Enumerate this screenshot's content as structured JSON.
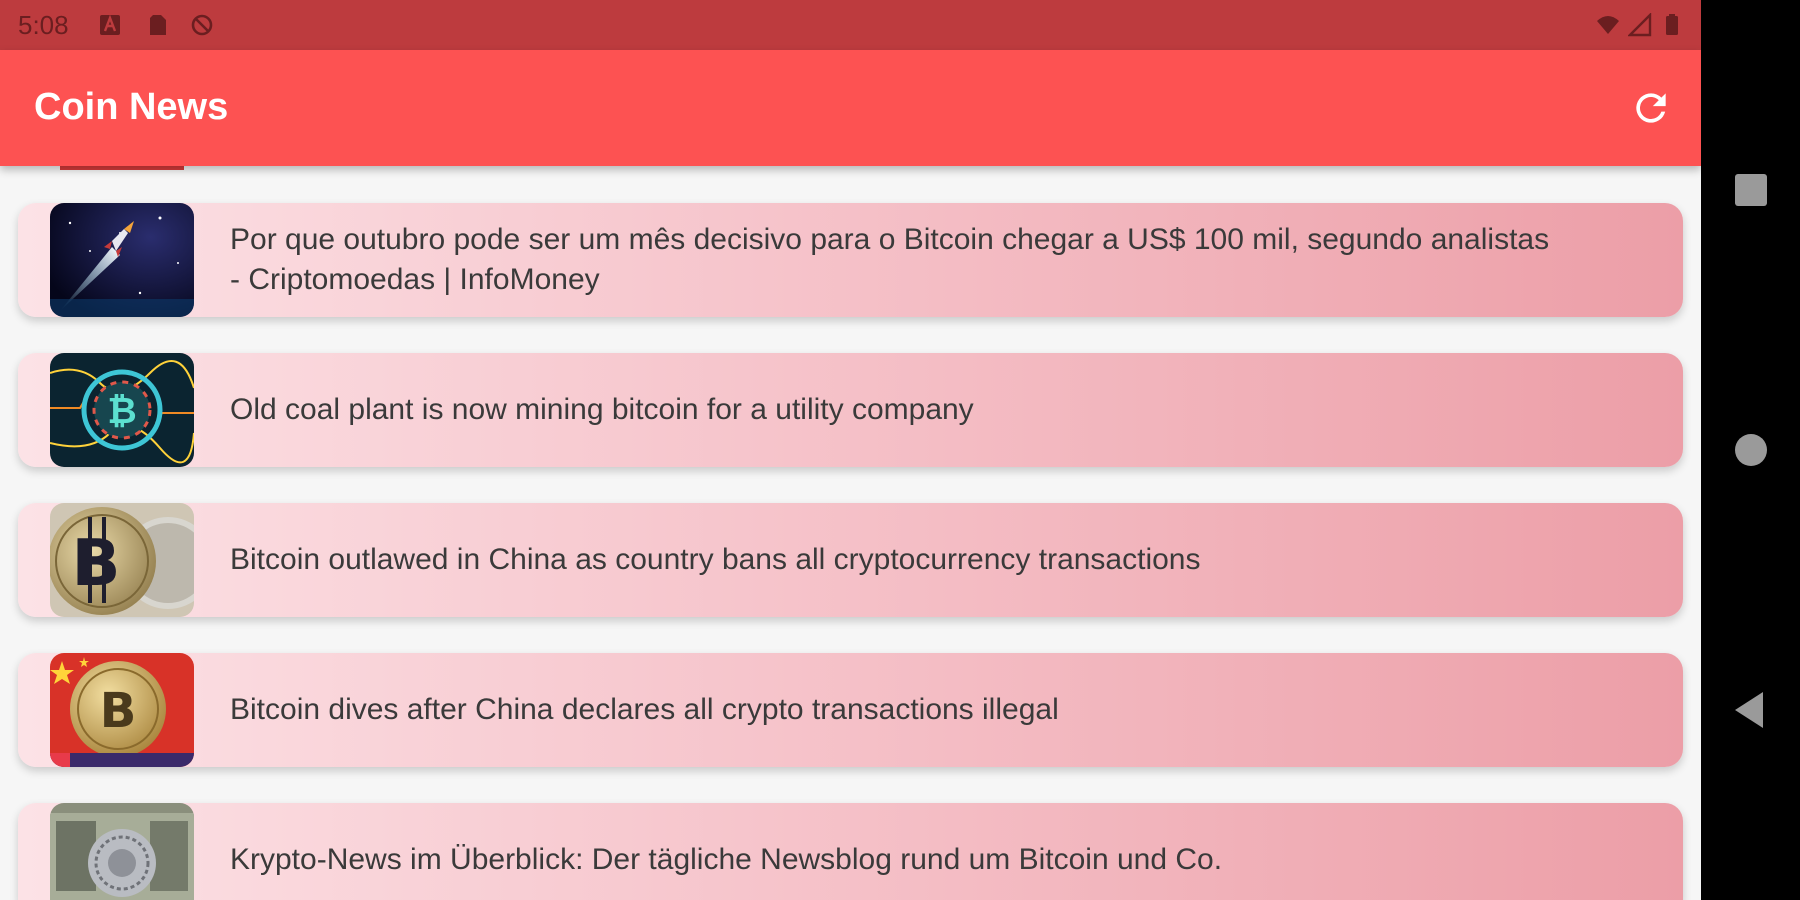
{
  "status_bar": {
    "time": "5:08",
    "icons_left": [
      "font-icon",
      "sim-card-icon",
      "no-sync-icon"
    ],
    "icons_right": [
      "wifi-icon",
      "signal-icon",
      "battery-icon"
    ]
  },
  "app_bar": {
    "title": "Coin News",
    "refresh_icon": "refresh-icon",
    "color": "#fd5252"
  },
  "news": [
    {
      "title": "Por que outubro pode ser um mês decisivo para o Bitcoin chegar a US$ 100 mil, segundo analistas - Criptomoedas | InfoMoney",
      "thumbnail": "rocket-image"
    },
    {
      "title": "Old coal plant is now mining bitcoin for a utility company",
      "thumbnail": "bitcoin-circuit-image"
    },
    {
      "title": "Bitcoin outlawed in China as country bans all cryptocurrency transactions",
      "thumbnail": "bitcoin-coins-image"
    },
    {
      "title": "Bitcoin dives after China declares all crypto transactions illegal",
      "thumbnail": "bitcoin-china-flag-image"
    },
    {
      "title": "Krypto-News im Überblick: Der tägliche Newsblog rund um Bitcoin und Co.",
      "thumbnail": "coin-on-banknote-image"
    }
  ],
  "nav_bar": {
    "buttons": [
      "recents-button",
      "home-button",
      "back-button"
    ]
  }
}
